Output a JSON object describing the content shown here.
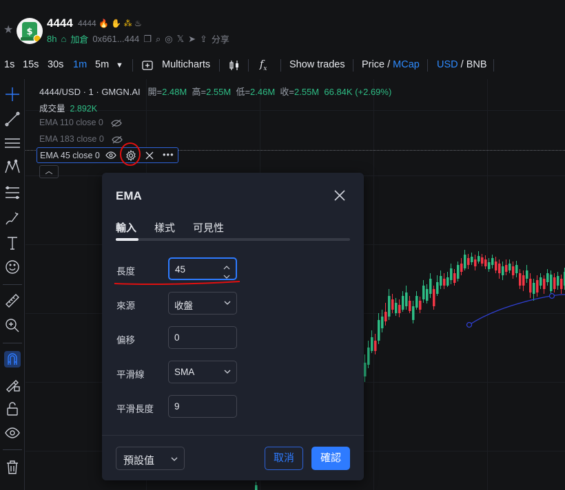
{
  "header": {
    "token_name": "4444",
    "token_sub": "4444",
    "age": "8h",
    "add_position": "加倉",
    "address": "0x661...444",
    "share": "分享"
  },
  "toolbar": {
    "intervals": [
      "1s",
      "15s",
      "30s",
      "1m",
      "5m"
    ],
    "active_interval": "1m",
    "multicharts": "Multicharts",
    "show_trades": "Show trades",
    "price": "Price",
    "mcap": "MCap",
    "usd": "USD",
    "bnb": "BNB"
  },
  "legend": {
    "symbol": "4444/USD · 1 · GMGN.AI",
    "open_label": "開=",
    "open": "2.48M",
    "high_label": "高=",
    "high": "2.55M",
    "low_label": "低=",
    "low": "2.46M",
    "close_label": "收=",
    "close": "2.55M",
    "change": "66.84K (+2.69%)",
    "volume_label": "成交量",
    "volume": "2.892K",
    "ema110": "EMA 110 close 0",
    "ema183": "EMA 183 close 0",
    "ema45": "EMA 45 close 0"
  },
  "dialog": {
    "title": "EMA",
    "tabs": [
      "輸入",
      "樣式",
      "可見性"
    ],
    "fields": {
      "length_label": "長度",
      "length_value": "45",
      "source_label": "來源",
      "source_value": "收盤",
      "offset_label": "偏移",
      "offset_value": "0",
      "smoothing_label": "平滑線",
      "smoothing_value": "SMA",
      "smoothing_length_label": "平滑長度",
      "smoothing_length_value": "9"
    },
    "defaults_label": "預設值",
    "cancel_label": "取消",
    "ok_label": "確認"
  },
  "colors": {
    "up": "#2ebd85",
    "down": "#f23645",
    "accent": "#2e7bff",
    "ema_line": "#2f3fd0",
    "annotation": "#e01010"
  }
}
